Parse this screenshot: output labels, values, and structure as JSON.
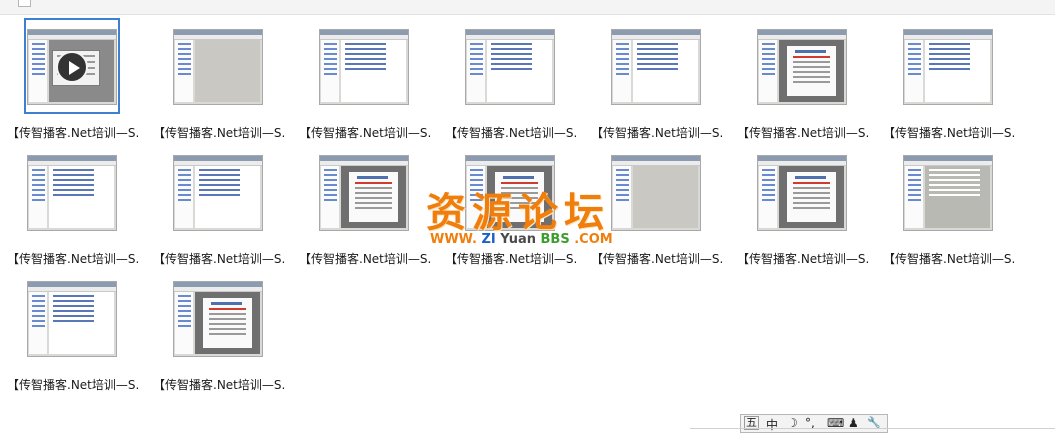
{
  "caption": "【传智播客.Net培训—S...",
  "tiles": [
    {
      "caption": "【传智播客.Net培训—S...",
      "variant": "win",
      "video": true,
      "selected": true
    },
    {
      "caption": "【传智播客.Net培训—S...",
      "variant": "blank"
    },
    {
      "caption": "【传智播客.Net培训—S...",
      "variant": "code"
    },
    {
      "caption": "【传智播客.Net培训—S...",
      "variant": "code"
    },
    {
      "caption": "【传智播客.Net培训—S...",
      "variant": "code"
    },
    {
      "caption": "【传智播客.Net培训—S...",
      "variant": "slide"
    },
    {
      "caption": "【传智播客.Net培训—S...",
      "variant": "code"
    },
    {
      "caption": "【传智播客.Net培训—S...",
      "variant": "code"
    },
    {
      "caption": "【传智播客.Net培训—S...",
      "variant": "code"
    },
    {
      "caption": "【传智播客.Net培训—S...",
      "variant": "slide"
    },
    {
      "caption": "【传智播客.Net培训—S...",
      "variant": "slide"
    },
    {
      "caption": "【传智播客.Net培训—S...",
      "variant": "blank"
    },
    {
      "caption": "【传智播客.Net培训—S...",
      "variant": "slide"
    },
    {
      "caption": "【传智播客.Net培训—S...",
      "variant": "dark"
    },
    {
      "caption": "【传智播客.Net培训—S...",
      "variant": "code"
    },
    {
      "caption": "【传智播客.Net培训—S...",
      "variant": "slide"
    }
  ],
  "watermark": {
    "title": "资源论坛",
    "www": "WWW.",
    "zi": "ZI",
    "yuan": "Yuan",
    "bbs": "BBS",
    "com": ".COM"
  },
  "ime": {
    "mode": "中",
    "moon": "☽",
    "punct": "°,",
    "keyboard": "⌨",
    "user": "♟",
    "tool": "🔧",
    "icon": "五"
  }
}
